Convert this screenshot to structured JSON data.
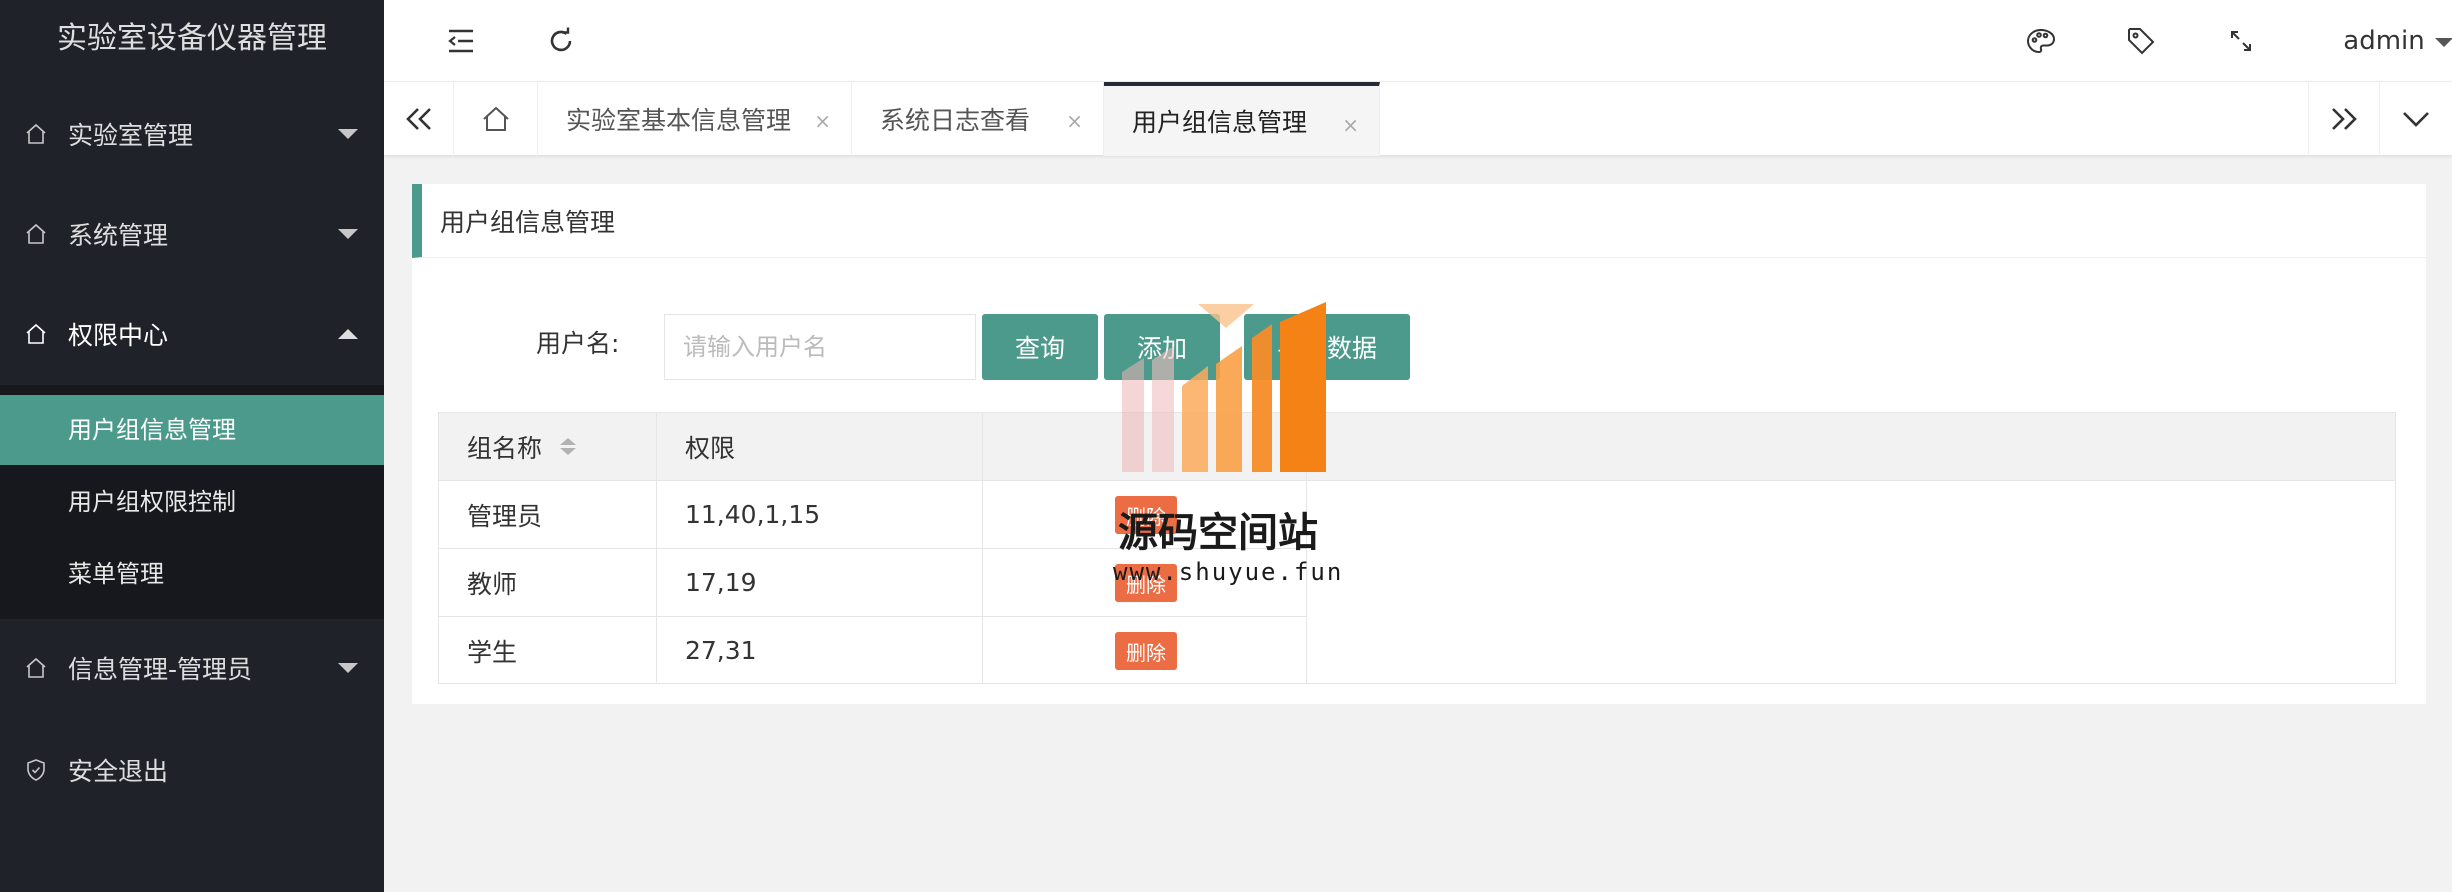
{
  "app": {
    "title": "实验室设备仪器管理"
  },
  "sidebar": {
    "items": [
      {
        "label": "实验室管理",
        "icon": "home-icon"
      },
      {
        "label": "系统管理",
        "icon": "home-icon"
      },
      {
        "label": "权限中心",
        "icon": "home-icon",
        "expanded": true
      },
      {
        "label": "信息管理-管理员",
        "icon": "home-icon"
      },
      {
        "label": "安全退出",
        "icon": "shield-check-icon"
      }
    ],
    "submenu": [
      {
        "label": "用户组信息管理",
        "active": true
      },
      {
        "label": "用户组权限控制"
      },
      {
        "label": "菜单管理"
      }
    ]
  },
  "header": {
    "user": "admin",
    "icons": [
      "menu-fold-icon",
      "refresh-icon",
      "palette-icon",
      "tag-icon",
      "fullscreen-icon"
    ]
  },
  "tabs": {
    "items": [
      {
        "label": "实验室基本信息管理"
      },
      {
        "label": "系统日志查看"
      },
      {
        "label": "用户组信息管理",
        "active": true
      }
    ],
    "close_symbol": "×"
  },
  "page": {
    "title": "用户组信息管理",
    "form": {
      "label": "用户名:",
      "placeholder": "请输入用户名",
      "query_button": "查询",
      "add_button": "添加",
      "export_button": "导出数据"
    },
    "table": {
      "headers": [
        "组名称",
        "权限"
      ],
      "rows": [
        {
          "name": "管理员",
          "perm": "11,40,1,15",
          "action": "删除"
        },
        {
          "name": "教师",
          "perm": "17,19",
          "action": "删除"
        },
        {
          "name": "学生",
          "perm": "27,31",
          "action": "删除"
        }
      ]
    }
  },
  "watermark": {
    "text": "源码空间站",
    "url": "www.shuyue.fun"
  },
  "colors": {
    "sidebar_bg": "#20222a",
    "accent": "#4c9a8c",
    "danger": "#ec6c44"
  }
}
